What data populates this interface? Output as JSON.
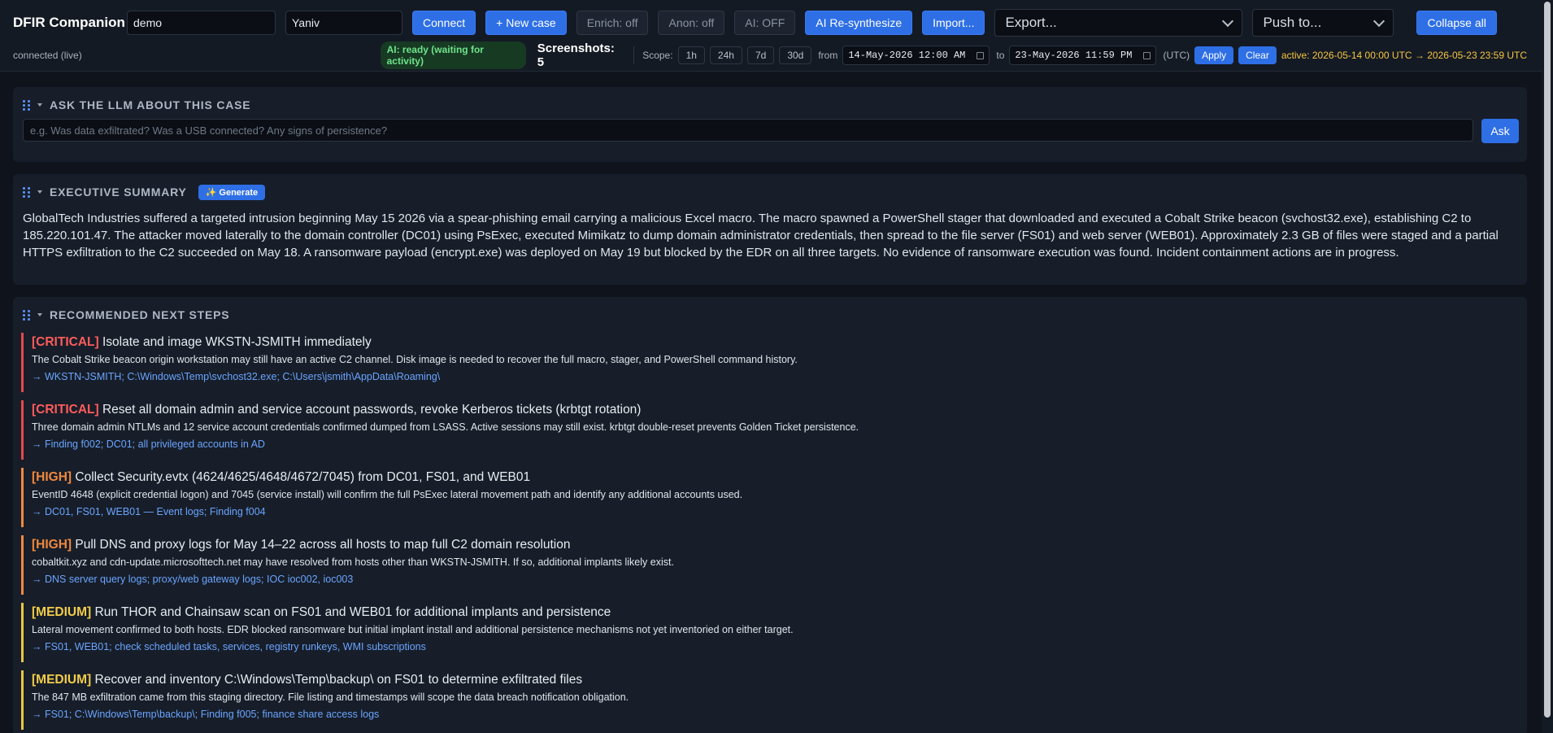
{
  "header": {
    "app_title": "DFIR Companion",
    "case_input_value": "demo",
    "user_input_value": "Yaniv",
    "connect_label": "Connect",
    "new_case_label": "+ New case",
    "enrich_label": "Enrich: off",
    "anon_label": "Anon: off",
    "ai_toggle_label": "AI: OFF",
    "resynth_label": "AI Re-synthesize",
    "import_label": "Import...",
    "export_select": "Export...",
    "push_select": "Push to...",
    "collapse_label": "Collapse all"
  },
  "statusbar": {
    "connection": "connected (live)",
    "ai_status": "AI: ready (waiting for activity)",
    "screenshots": "Screenshots: 5",
    "scope_label": "Scope:",
    "scope_options": [
      "1h",
      "24h",
      "7d",
      "30d"
    ],
    "from_label": "from",
    "from_value": "14-May-2026 12:00 AM",
    "to_label": "to",
    "to_value": "23-May-2026 11:59 PM",
    "tz_label": "(UTC)",
    "apply_label": "Apply",
    "clear_label": "Clear",
    "active_range": "active: 2026-05-14 00:00 UTC → 2026-05-23 23:59 UTC"
  },
  "ask_panel": {
    "title": "ASK THE LLM ABOUT THIS CASE",
    "placeholder": "e.g. Was data exfiltrated? Was a USB connected? Any signs of persistence?",
    "ask_label": "Ask"
  },
  "summary_panel": {
    "title": "EXECUTIVE SUMMARY",
    "generate_label": "✨ Generate",
    "text": "GlobalTech Industries suffered a targeted intrusion beginning May 15 2026 via a spear-phishing email carrying a malicious Excel macro. The macro spawned a PowerShell stager that downloaded and executed a Cobalt Strike beacon (svchost32.exe), establishing C2 to 185.220.101.47. The attacker moved laterally to the domain controller (DC01) using PsExec, executed Mimikatz to dump domain administrator credentials, then spread to the file server (FS01) and web server (WEB01). Approximately 2.3 GB of files were staged and a partial HTTPS exfiltration to the C2 succeeded on May 18. A ransomware payload (encrypt.exe) was deployed on May 19 but blocked by the EDR on all three targets. No evidence of ransomware execution was found. Incident containment actions are in progress."
  },
  "steps_panel": {
    "title": "RECOMMENDED NEXT STEPS",
    "steps": [
      {
        "severity": "critical",
        "tag": "[CRITICAL]",
        "title": "Isolate and image WKSTN-JSMITH immediately",
        "desc": "The Cobalt Strike beacon origin workstation may still have an active C2 channel. Disk image is needed to recover the full macro, stager, and PowerShell command history.",
        "ref": "→ WKSTN-JSMITH; C:\\Windows\\Temp\\svchost32.exe; C:\\Users\\jsmith\\AppData\\Roaming\\"
      },
      {
        "severity": "critical",
        "tag": "[CRITICAL]",
        "title": "Reset all domain admin and service account passwords, revoke Kerberos tickets (krbtgt rotation)",
        "desc": "Three domain admin NTLMs and 12 service account credentials confirmed dumped from LSASS. Active sessions may still exist. krbtgt double-reset prevents Golden Ticket persistence.",
        "ref": "→ Finding f002; DC01; all privileged accounts in AD"
      },
      {
        "severity": "high",
        "tag": "[HIGH]",
        "title": "Collect Security.evtx (4624/4625/4648/4672/7045) from DC01, FS01, and WEB01",
        "desc": "EventID 4648 (explicit credential logon) and 7045 (service install) will confirm the full PsExec lateral movement path and identify any additional accounts used.",
        "ref": "→ DC01, FS01, WEB01 — Event logs; Finding f004"
      },
      {
        "severity": "high",
        "tag": "[HIGH]",
        "title": "Pull DNS and proxy logs for May 14–22 across all hosts to map full C2 domain resolution",
        "desc": "cobaltkit.xyz and cdn-update.microsofttech.net may have resolved from hosts other than WKSTN-JSMITH. If so, additional implants likely exist.",
        "ref": "→ DNS server query logs; proxy/web gateway logs; IOC ioc002, ioc003"
      },
      {
        "severity": "medium",
        "tag": "[MEDIUM]",
        "title": "Run THOR and Chainsaw scan on FS01 and WEB01 for additional implants and persistence",
        "desc": "Lateral movement confirmed to both hosts. EDR blocked ransomware but initial implant install and additional persistence mechanisms not yet inventoried on either target.",
        "ref": "→ FS01, WEB01; check scheduled tasks, services, registry runkeys, WMI subscriptions"
      },
      {
        "severity": "medium",
        "tag": "[MEDIUM]",
        "title": "Recover and inventory C:\\Windows\\Temp\\backup\\ on FS01 to determine exfiltrated files",
        "desc": "The 847 MB exfiltration came from this staging directory. File listing and timestamps will scope the data breach notification obligation.",
        "ref": "→ FS01; C:\\Windows\\Temp\\backup\\; Finding f005; finance share access logs"
      }
    ]
  }
}
